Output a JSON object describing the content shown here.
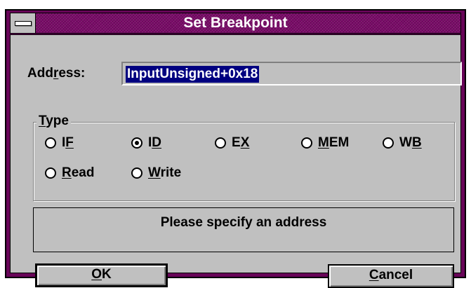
{
  "window": {
    "title": "Set Breakpoint",
    "title_bar_color": "#680458",
    "face_color": "#c0c0c0"
  },
  "address": {
    "label_pre": "Add",
    "label_accel": "r",
    "label_post": "ess:",
    "value": "InputUnsigned+0x18",
    "selection_color": "#000080"
  },
  "type_group": {
    "title_accel": "T",
    "title_rest": "ype",
    "options": [
      {
        "pre": "I",
        "accel": "F",
        "post": "",
        "checked": false
      },
      {
        "pre": "I",
        "accel": "D",
        "post": "",
        "checked": true
      },
      {
        "pre": "E",
        "accel": "X",
        "post": "",
        "checked": false
      },
      {
        "pre": "",
        "accel": "M",
        "post": "EM",
        "checked": false
      },
      {
        "pre": "W",
        "accel": "B",
        "post": "",
        "checked": false
      },
      {
        "pre": "",
        "accel": "R",
        "post": "ead",
        "checked": false
      },
      {
        "pre": "",
        "accel": "W",
        "post": "rite",
        "checked": false
      }
    ]
  },
  "status": {
    "message": "Please specify an address"
  },
  "buttons": {
    "ok_accel": "O",
    "ok_rest": "K",
    "cancel_accel": "C",
    "cancel_rest": "ancel"
  }
}
